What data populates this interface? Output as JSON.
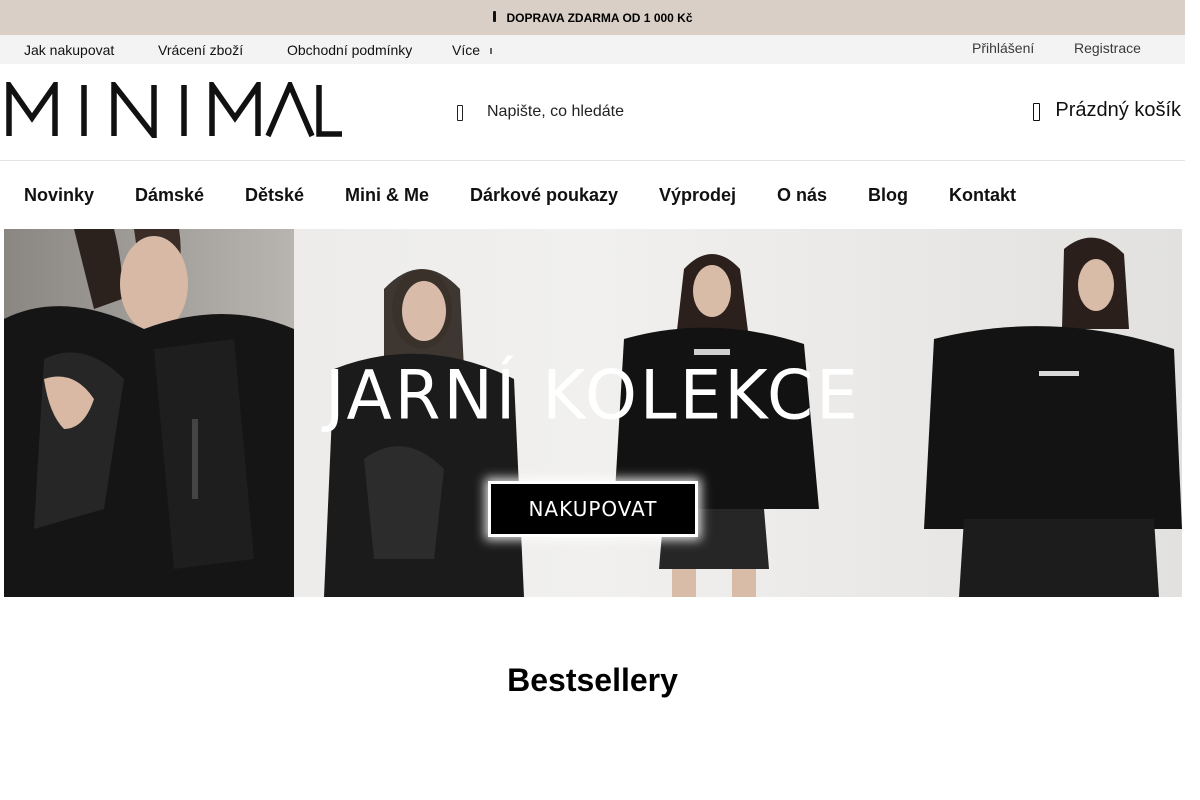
{
  "announcement": {
    "text": "DOPRAVA ZDARMA OD 1 000 Kč",
    "icon": "truck-icon"
  },
  "utility_nav": {
    "links": [
      "Jak nakupovat",
      "Vrácení zboží",
      "Obchodní podmínky",
      "Více"
    ],
    "login": "Přihlášení",
    "register": "Registrace"
  },
  "header": {
    "logo_text": "MINIMAL",
    "search_placeholder": "Napište, co hledáte",
    "cart_label": "Prázdný košík"
  },
  "main_nav": [
    "Novinky",
    "Dámské",
    "Dětské",
    "Mini & Me",
    "Dárkové poukazy",
    "Výprodej",
    "O nás",
    "Blog",
    "Kontakt"
  ],
  "hero": {
    "title": "JARNÍ KOLEKCE",
    "button": "NAKUPOVAT"
  },
  "section": {
    "title": "Bestsellery"
  },
  "colors": {
    "announcement_bg": "#d9cfc6",
    "utility_bg": "#f3f3f3",
    "button_bg": "#000000"
  }
}
